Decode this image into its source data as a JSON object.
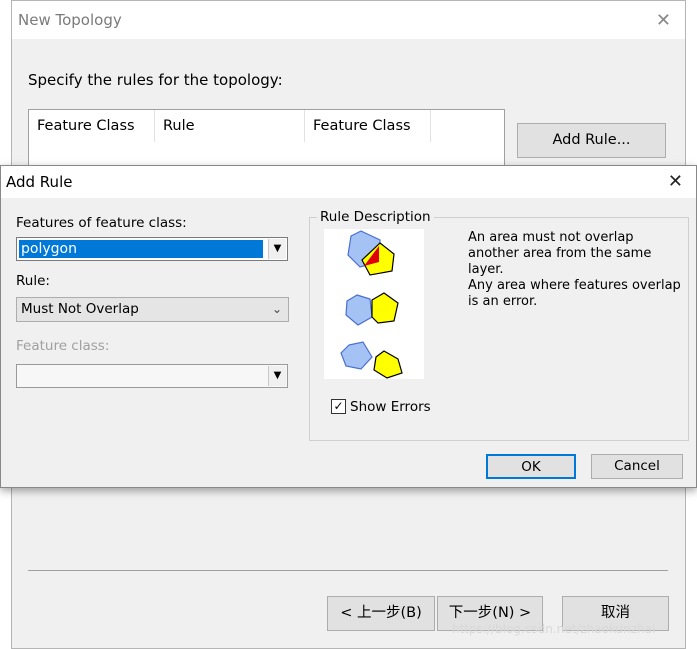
{
  "background_window": {
    "title": "New Topology",
    "close_glyph": "✕",
    "instruction": "Specify the rules for the topology:",
    "table_headers": [
      "Feature Class",
      "Rule",
      "Feature Class"
    ],
    "add_rule_button": "Add Rule...",
    "back_button": "< 上一步(B)",
    "next_button": "下一步(N) >",
    "cancel_button": "取消",
    "watermark": "https://blog.csdn.net/zhaokunzhai"
  },
  "dialog": {
    "title": "Add Rule",
    "close_glyph": "✕",
    "features_label": "Features of feature class:",
    "features_value": "polygon",
    "rule_label": "Rule:",
    "rule_value": "Must Not Overlap",
    "feature_class_label": "Feature class:",
    "feature_class_value": "",
    "rule_description_title": "Rule Description",
    "description_line1": "An area must not overlap another area from the same layer.",
    "description_line2": "Any area where features overlap is an error.",
    "show_errors_label": "Show Errors",
    "show_errors_checked": true,
    "ok_button": "OK",
    "cancel_button": "Cancel"
  },
  "icons": {
    "dropdown": "▼",
    "chevron": "⌄",
    "check": "✓"
  },
  "colors": {
    "accent": "#0078d7",
    "polygon_blue": "#a4c2f4",
    "polygon_yellow": "#ffff00",
    "error_red": "#e00000"
  }
}
